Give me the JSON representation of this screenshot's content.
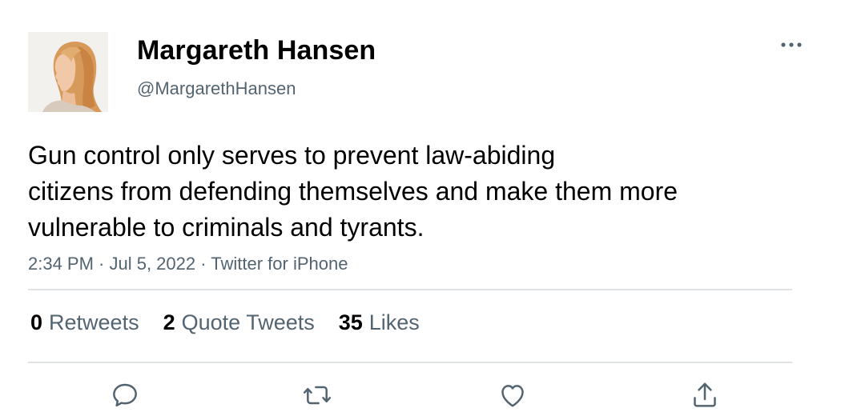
{
  "user": {
    "display_name": "Margareth Hansen",
    "handle": "@MargarethHansen",
    "avatar_icon": "profile-photo"
  },
  "tweet": {
    "text_lines": [
      "Gun control only serves to prevent law-abiding",
      "citizens from defending themselves and make them more",
      "vulnerable to criminals and tyrants."
    ],
    "meta": "2:34 PM · Jul 5, 2022 · Twitter for iPhone"
  },
  "stats": {
    "retweets": {
      "count": "0",
      "label": "Retweets"
    },
    "quote_tweets": {
      "count": "2",
      "label": "Quote Tweets"
    },
    "likes": {
      "count": "35",
      "label": "Likes"
    }
  },
  "actions": {
    "reply_icon": "speech-bubble-icon",
    "retweet_icon": "retweet-arrows-icon",
    "like_icon": "heart-icon",
    "share_icon": "share-upload-icon",
    "more_icon": "ellipsis-icon"
  },
  "colors": {
    "text_primary": "#000000",
    "text_secondary": "#536471",
    "divider": "#dfe3e6"
  }
}
